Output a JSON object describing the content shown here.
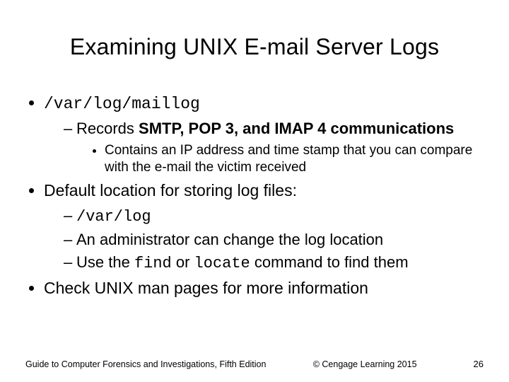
{
  "title": "Examining UNIX E-mail Server Logs",
  "b1": {
    "code": "/var/log/maillog",
    "s1": {
      "pre": "Records ",
      "strong": "SMTP, POP 3, and IMAP 4 communications"
    },
    "s1a": "Contains an IP address and time stamp that you can compare with the e-mail the victim received"
  },
  "b2": {
    "text": "Default location for storing log files:",
    "s1": "/var/log",
    "s2": "An administrator can change the log location",
    "s3_a": "Use the ",
    "s3_find": "find",
    "s3_b": " or ",
    "s3_locate": "locate",
    "s3_c": " command to find them"
  },
  "b3": "Check UNIX man pages for more information",
  "footer": {
    "left": "Guide to Computer Forensics and Investigations, Fifth Edition",
    "copyright": "© Cengage Learning  2015",
    "page": "26"
  }
}
